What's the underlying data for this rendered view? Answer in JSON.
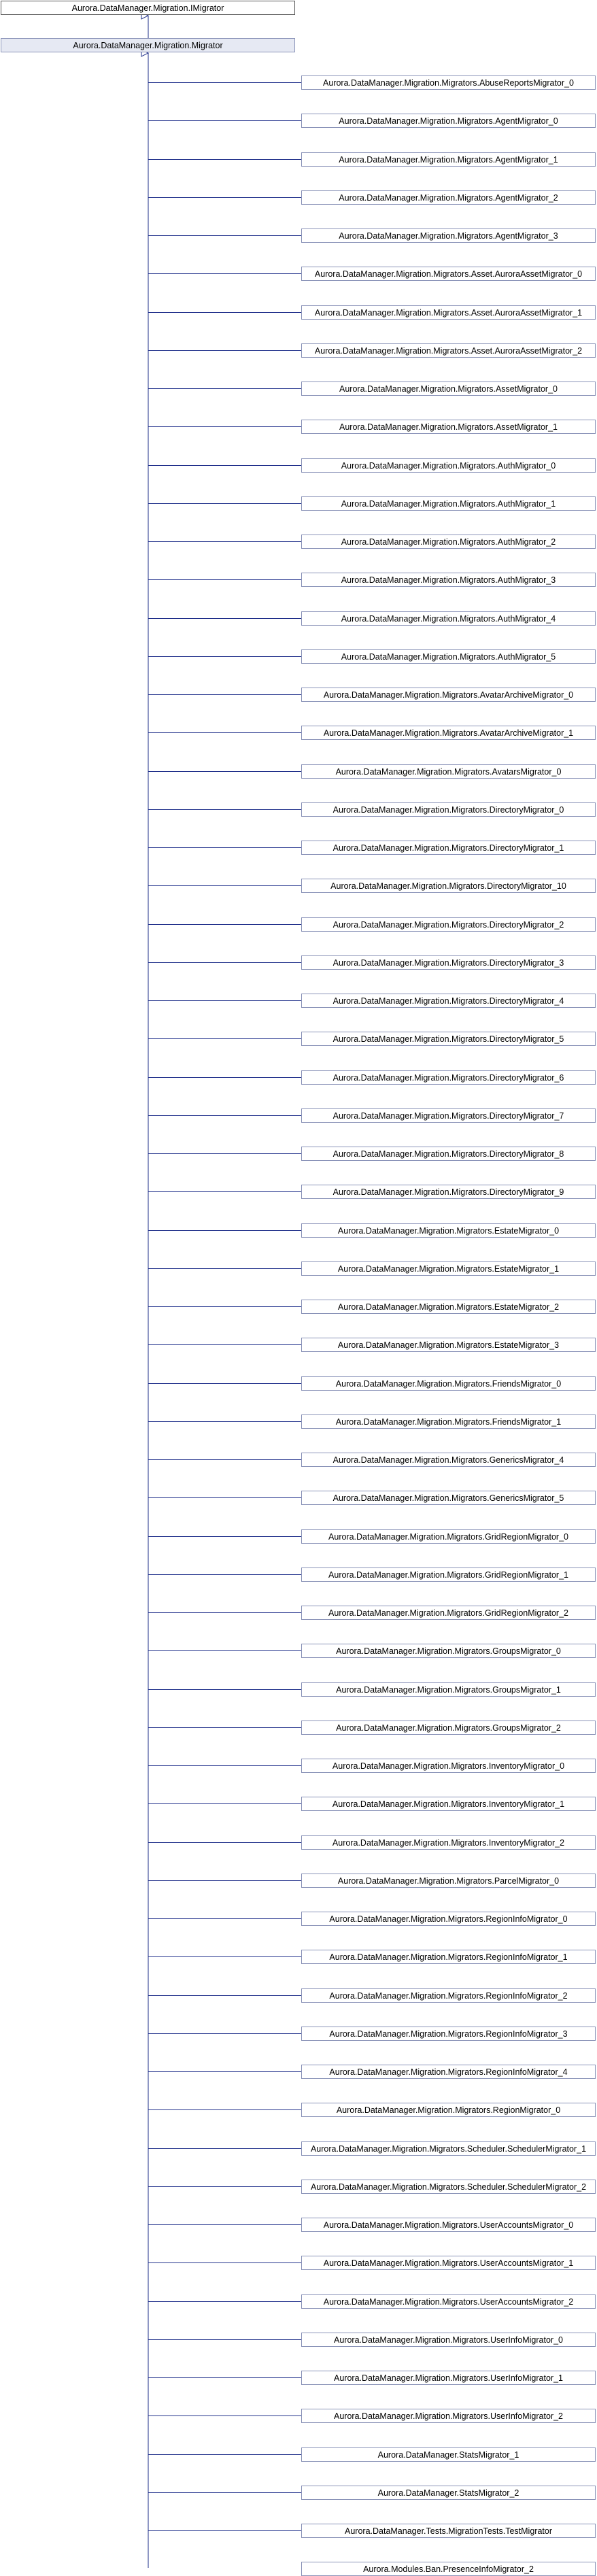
{
  "interface": "Aurora.DataManager.Migration.IMigrator",
  "base": "Aurora.DataManager.Migration.Migrator",
  "children": [
    "Aurora.DataManager.Migration.Migrators.AbuseReportsMigrator_0",
    "Aurora.DataManager.Migration.Migrators.AgentMigrator_0",
    "Aurora.DataManager.Migration.Migrators.AgentMigrator_1",
    "Aurora.DataManager.Migration.Migrators.AgentMigrator_2",
    "Aurora.DataManager.Migration.Migrators.AgentMigrator_3",
    "Aurora.DataManager.Migration.Migrators.Asset.AuroraAssetMigrator_0",
    "Aurora.DataManager.Migration.Migrators.Asset.AuroraAssetMigrator_1",
    "Aurora.DataManager.Migration.Migrators.Asset.AuroraAssetMigrator_2",
    "Aurora.DataManager.Migration.Migrators.AssetMigrator_0",
    "Aurora.DataManager.Migration.Migrators.AssetMigrator_1",
    "Aurora.DataManager.Migration.Migrators.AuthMigrator_0",
    "Aurora.DataManager.Migration.Migrators.AuthMigrator_1",
    "Aurora.DataManager.Migration.Migrators.AuthMigrator_2",
    "Aurora.DataManager.Migration.Migrators.AuthMigrator_3",
    "Aurora.DataManager.Migration.Migrators.AuthMigrator_4",
    "Aurora.DataManager.Migration.Migrators.AuthMigrator_5",
    "Aurora.DataManager.Migration.Migrators.AvatarArchiveMigrator_0",
    "Aurora.DataManager.Migration.Migrators.AvatarArchiveMigrator_1",
    "Aurora.DataManager.Migration.Migrators.AvatarsMigrator_0",
    "Aurora.DataManager.Migration.Migrators.DirectoryMigrator_0",
    "Aurora.DataManager.Migration.Migrators.DirectoryMigrator_1",
    "Aurora.DataManager.Migration.Migrators.DirectoryMigrator_10",
    "Aurora.DataManager.Migration.Migrators.DirectoryMigrator_2",
    "Aurora.DataManager.Migration.Migrators.DirectoryMigrator_3",
    "Aurora.DataManager.Migration.Migrators.DirectoryMigrator_4",
    "Aurora.DataManager.Migration.Migrators.DirectoryMigrator_5",
    "Aurora.DataManager.Migration.Migrators.DirectoryMigrator_6",
    "Aurora.DataManager.Migration.Migrators.DirectoryMigrator_7",
    "Aurora.DataManager.Migration.Migrators.DirectoryMigrator_8",
    "Aurora.DataManager.Migration.Migrators.DirectoryMigrator_9",
    "Aurora.DataManager.Migration.Migrators.EstateMigrator_0",
    "Aurora.DataManager.Migration.Migrators.EstateMigrator_1",
    "Aurora.DataManager.Migration.Migrators.EstateMigrator_2",
    "Aurora.DataManager.Migration.Migrators.EstateMigrator_3",
    "Aurora.DataManager.Migration.Migrators.FriendsMigrator_0",
    "Aurora.DataManager.Migration.Migrators.FriendsMigrator_1",
    "Aurora.DataManager.Migration.Migrators.GenericsMigrator_4",
    "Aurora.DataManager.Migration.Migrators.GenericsMigrator_5",
    "Aurora.DataManager.Migration.Migrators.GridRegionMigrator_0",
    "Aurora.DataManager.Migration.Migrators.GridRegionMigrator_1",
    "Aurora.DataManager.Migration.Migrators.GridRegionMigrator_2",
    "Aurora.DataManager.Migration.Migrators.GroupsMigrator_0",
    "Aurora.DataManager.Migration.Migrators.GroupsMigrator_1",
    "Aurora.DataManager.Migration.Migrators.GroupsMigrator_2",
    "Aurora.DataManager.Migration.Migrators.InventoryMigrator_0",
    "Aurora.DataManager.Migration.Migrators.InventoryMigrator_1",
    "Aurora.DataManager.Migration.Migrators.InventoryMigrator_2",
    "Aurora.DataManager.Migration.Migrators.ParcelMigrator_0",
    "Aurora.DataManager.Migration.Migrators.RegionInfoMigrator_0",
    "Aurora.DataManager.Migration.Migrators.RegionInfoMigrator_1",
    "Aurora.DataManager.Migration.Migrators.RegionInfoMigrator_2",
    "Aurora.DataManager.Migration.Migrators.RegionInfoMigrator_3",
    "Aurora.DataManager.Migration.Migrators.RegionInfoMigrator_4",
    "Aurora.DataManager.Migration.Migrators.RegionMigrator_0",
    "Aurora.DataManager.Migration.Migrators.Scheduler.SchedulerMigrator_1",
    "Aurora.DataManager.Migration.Migrators.Scheduler.SchedulerMigrator_2",
    "Aurora.DataManager.Migration.Migrators.UserAccountsMigrator_0",
    "Aurora.DataManager.Migration.Migrators.UserAccountsMigrator_1",
    "Aurora.DataManager.Migration.Migrators.UserAccountsMigrator_2",
    "Aurora.DataManager.Migration.Migrators.UserInfoMigrator_0",
    "Aurora.DataManager.Migration.Migrators.UserInfoMigrator_1",
    "Aurora.DataManager.Migration.Migrators.UserInfoMigrator_2",
    "Aurora.DataManager.StatsMigrator_1",
    "Aurora.DataManager.StatsMigrator_2",
    "Aurora.DataManager.Tests.MigrationTests.TestMigrator",
    "Aurora.Modules.Ban.PresenceInfoMigrator_2"
  ],
  "colors": {
    "line": "#1f2f8a",
    "box_border": "#8a93b8",
    "base_fill": "#e6e9f3"
  }
}
